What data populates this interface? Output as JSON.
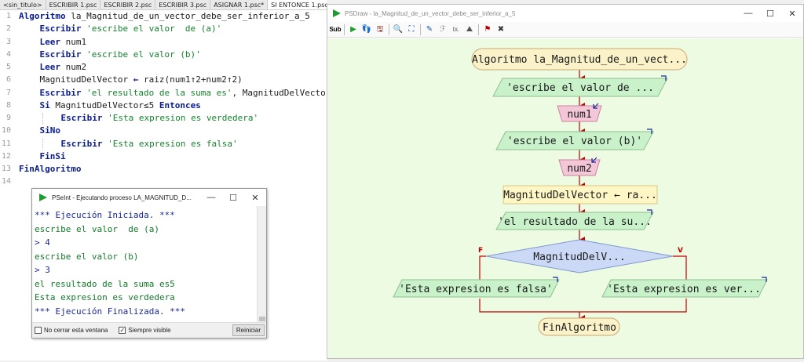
{
  "tabs": [
    "<sin_titulo>",
    "ESCRIBIR 1.psc",
    "ESCRIBIR 2.psc",
    "ESCRIBIR 3.psc",
    "ASIGNAR 1.psc*",
    "SI ENTONCE 1.psc*"
  ],
  "code": {
    "l1_kw": "Algoritmo",
    "l1_rest": " la_Magnitud_de_un_vector_debe_ser_inferior_a_5",
    "l2_kw": "Escribir",
    "l2_str": " 'escribe el valor  de (a)'",
    "l3_kw": "Leer",
    "l3_rest": " num1",
    "l4_kw": "Escribir",
    "l4_str": " 'escribe el valor (b)'",
    "l5_kw": "Leer",
    "l5_rest": " num2",
    "l6_a": "MagnitudDelVector ",
    "l6_op": "←",
    "l6_b": " raiz(num1↑2+num2↑2)",
    "l7_kw": "Escribir",
    "l7_str": " 'el resultado de la suma es'",
    "l7_rest": ", MagnitudDelVector",
    "l8_kw": "Si",
    "l8_rest": " MagnitudDelVector≤5 ",
    "l8_kw2": "Entonces",
    "l9_kw": "Escribir",
    "l9_str": " 'Esta expresion es verdedera'",
    "l10_kw": "SiNo",
    "l11_kw": "Escribir",
    "l11_str": " 'Esta expresion es falsa'",
    "l12_kw": "FinSi",
    "l13_kw": "FinAlgoritmo"
  },
  "console": {
    "title": "PSeInt - Ejecutando proceso LA_MAGNITUD_D...",
    "lines": [
      "*** Ejecución Iniciada. ***",
      "escribe el valor  de (a)",
      "> 4",
      "escribe el valor (b)",
      "> 3",
      "el resultado de la suma es5",
      "Esta expresion es verdedera",
      "*** Ejecución Finalizada. ***"
    ],
    "chk1": "No cerrar esta ventana",
    "chk2": "Siempre visible",
    "btn": "Reiniciar"
  },
  "psdraw": {
    "title": "PSDraw - la_Magnitud_de_un_vector_debe_ser_inferior_a_5",
    "nodes": {
      "start": "Algoritmo la_Magnitud_de_un_vect...",
      "out1": "'escribe el valor  de ...",
      "in1": "num1",
      "out2": "'escribe el valor (b)'",
      "in2": "num2",
      "assign": "MagnitudDelVector ← ra...",
      "out3": "'el resultado de la su...",
      "cond": "MagnitudDelV...",
      "f": "F",
      "v": "V",
      "outF": "'Esta expresion es falsa'",
      "outV": "'Esta expresion es ver...",
      "end": "FinAlgoritmo"
    },
    "colors": {
      "canvas": "#eefbe3",
      "arrow": "#c00000",
      "io": "#c9f2cb",
      "read": "#f4c7d8",
      "assign": "#fff6c5",
      "terminal": "#fcf2c9",
      "cond": "#cbd9f7"
    }
  }
}
